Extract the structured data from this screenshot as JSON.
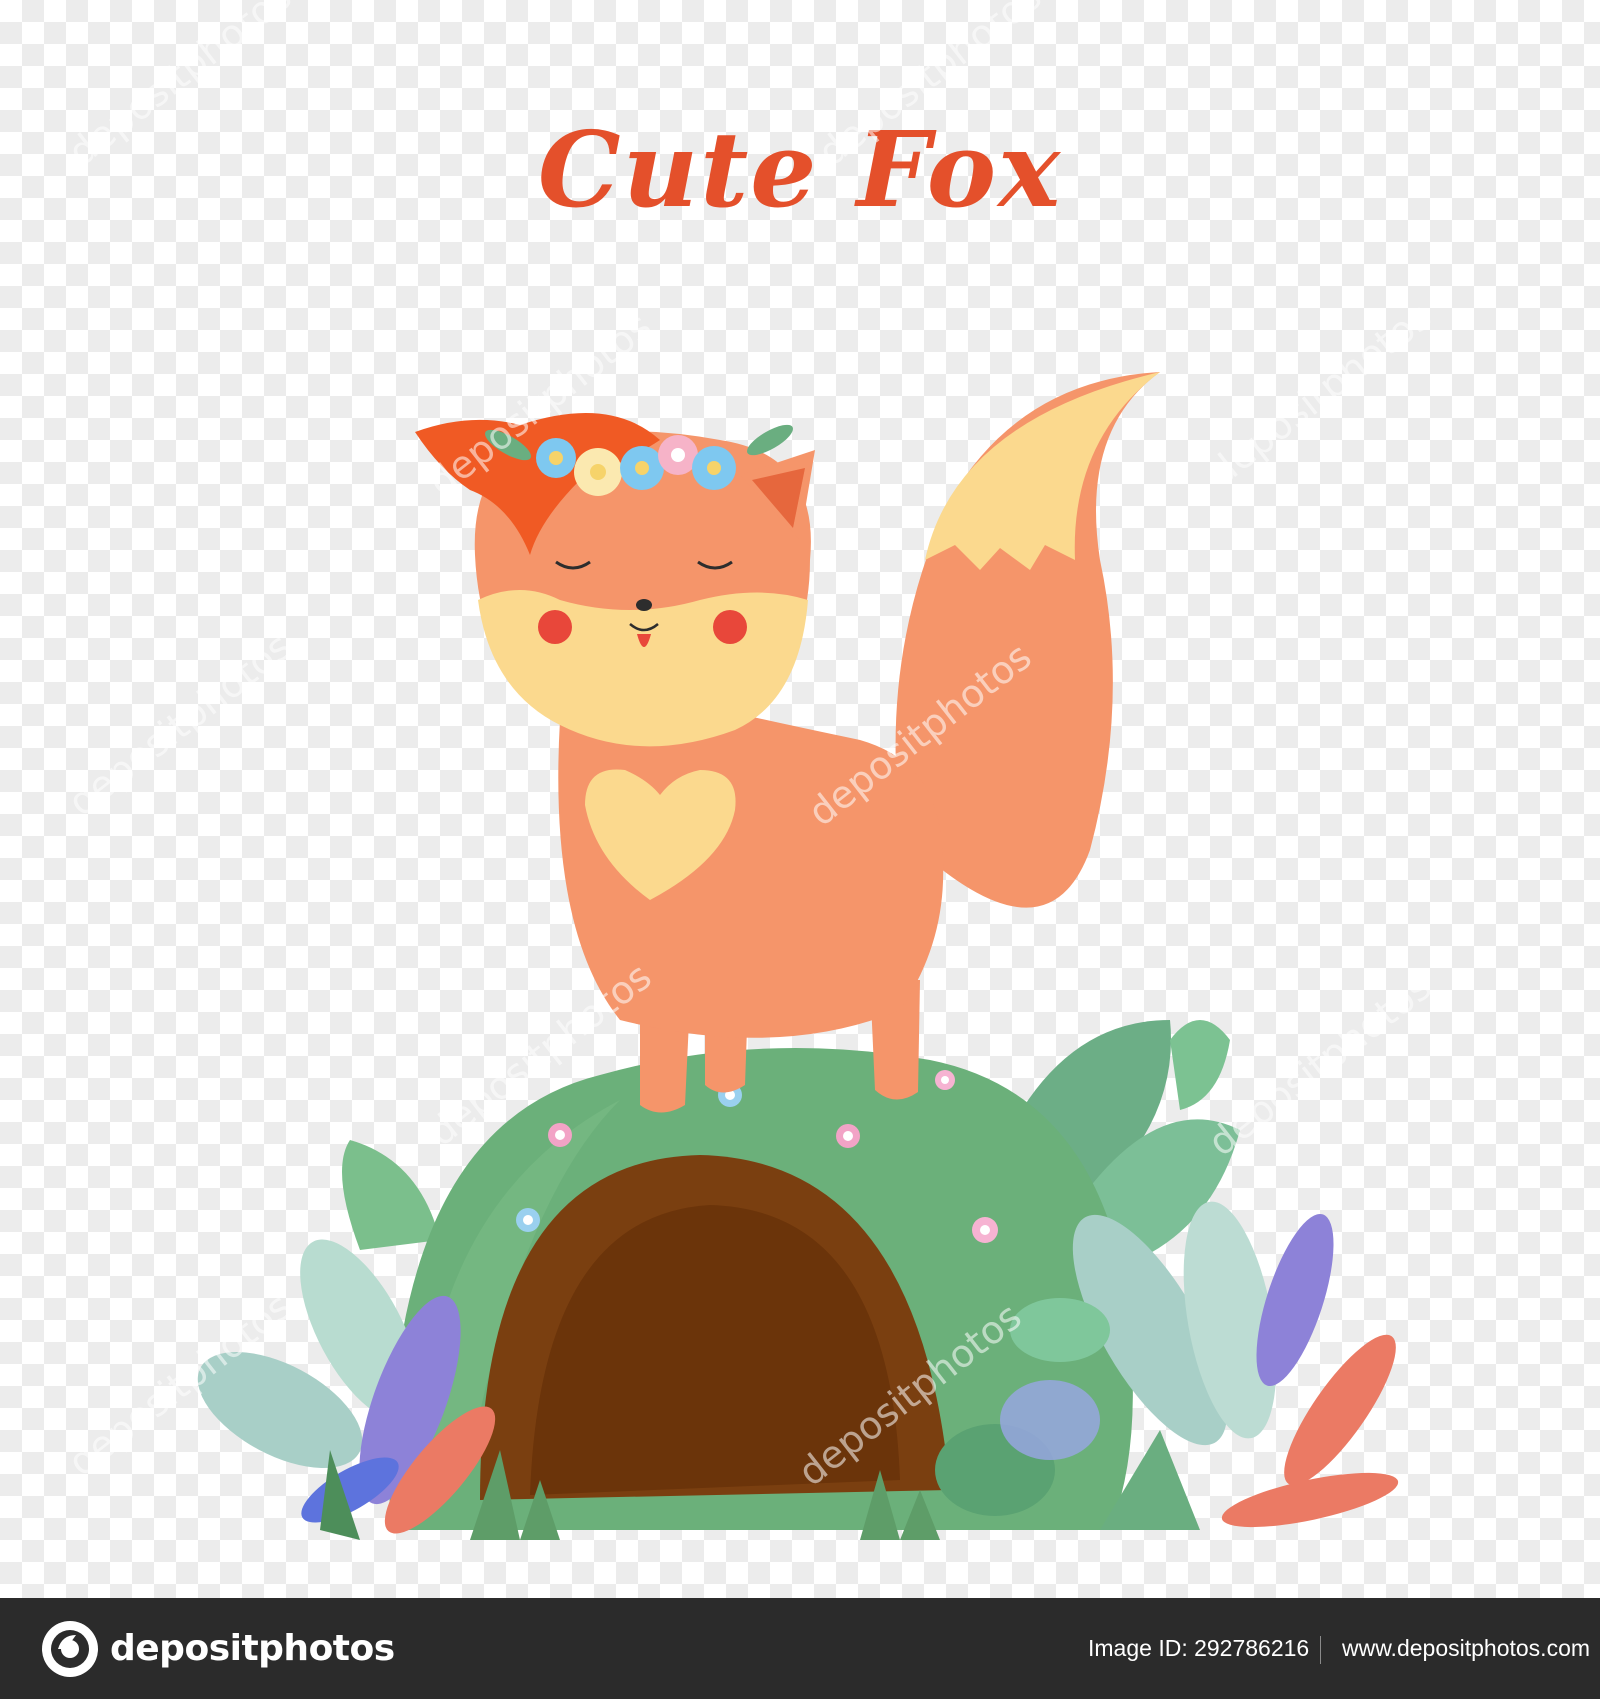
{
  "title": "Cute Fox",
  "watermark": {
    "text": "depositphotos"
  },
  "footer": {
    "brand": "depositphotos",
    "image_id": "Image ID: 292786216",
    "site": "www.depositphotos.com"
  },
  "colors": {
    "title": "#e4502b",
    "fox_body": "#f5956a",
    "fox_cream": "#fbd98e",
    "fox_hair": "#f05a24",
    "grass": "#6bb07a",
    "burrow": "#7a3f10",
    "footer_bg": "#2b2b2b"
  }
}
